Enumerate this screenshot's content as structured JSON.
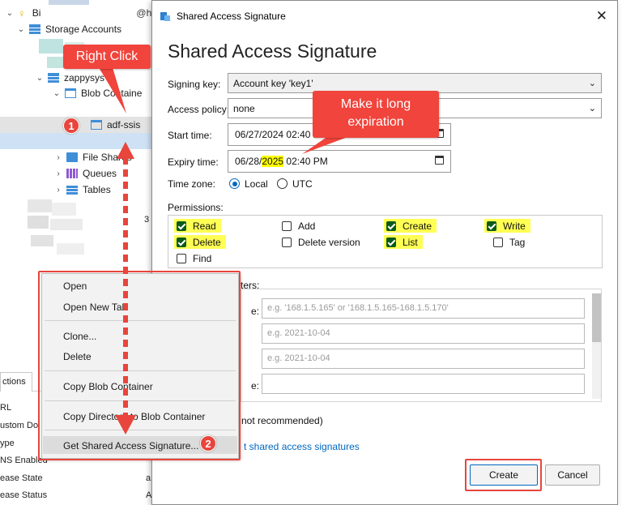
{
  "explorer": {
    "tree": {
      "root_label": "Bi",
      "root_suffix": "@h",
      "storage_accounts": "Storage Accounts",
      "account": "zappysys",
      "blob_containers": "Blob Containe",
      "container": "adf-ssis",
      "file_shares": "File Shares",
      "queues": "Queues",
      "tables": "Tables",
      "partial_num": "3"
    },
    "bottom": {
      "tab_actions": "ctions",
      "properties": [
        "RL",
        "ustom Do",
        "ype",
        "NS Enabled",
        "ease State",
        "ease Status"
      ],
      "side_letters": [
        "a",
        "A"
      ]
    }
  },
  "context_menu": {
    "items": [
      {
        "label": "Open"
      },
      {
        "label": "Open New Tab"
      },
      {
        "label": "Clone..."
      },
      {
        "label": "Delete"
      },
      {
        "label": "Copy Blob Container"
      },
      {
        "label": "Copy Directory to Blob Container"
      },
      {
        "label": "Get Shared Access Signature..."
      }
    ]
  },
  "dialog": {
    "window_title": "Shared Access Signature",
    "heading": "Shared Access Signature",
    "signing_key": {
      "label": "Signing key:",
      "value": "Account key 'key1'"
    },
    "access_policy": {
      "label": "Access policy:",
      "value": "none"
    },
    "start_time": {
      "label": "Start time:",
      "value": "06/27/2024 02:40 PM"
    },
    "expiry_time": {
      "label": "Expiry time:",
      "value_pre": "06/28/",
      "value_year": "2025",
      "value_post": " 02:40 PM"
    },
    "time_zone": {
      "label": "Time zone:",
      "options": [
        "Local",
        "UTC"
      ],
      "selected": "Local"
    },
    "permissions": {
      "label": "Permissions:",
      "items": [
        {
          "label": "Read",
          "checked": true
        },
        {
          "label": "Add",
          "checked": false
        },
        {
          "label": "Create",
          "checked": true
        },
        {
          "label": "Write",
          "checked": true
        },
        {
          "label": "Delete",
          "checked": true
        },
        {
          "label": "Delete version",
          "checked": false
        },
        {
          "label": "List",
          "checked": true
        },
        {
          "label": "Tag",
          "checked": false
        },
        {
          "label": "Find",
          "checked": false
        }
      ]
    },
    "advanced": {
      "label_fragment": "ters:",
      "row_label_1": "e:",
      "row_label_4": "e:",
      "placeholders": [
        "e.g. '168.1.5.165' or '168.1.5.165-168.1.5.170'",
        "e.g. 2021-10-04",
        "e.g. 2021-10-04",
        ""
      ]
    },
    "not_recommended": "not recommended)",
    "learn_link": "t shared access signatures",
    "buttons": {
      "create": "Create",
      "cancel": "Cancel"
    }
  },
  "annotations": {
    "right_click": "Right Click",
    "make_long": "Make it long expiration",
    "badge_1": "1",
    "badge_2": "2"
  },
  "colors": {
    "callout_red": "#f0443c",
    "highlight_yellow": "#ffff00",
    "accent_blue": "#0067c0",
    "checkbox_green": "#0a5a1a"
  }
}
